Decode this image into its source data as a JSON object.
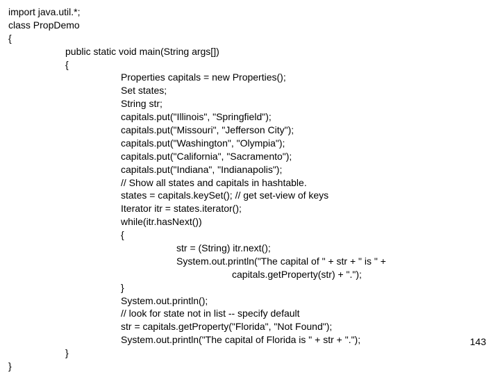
{
  "page_number": "143",
  "code": {
    "l01": "import java.util.*;",
    "l02": "class PropDemo",
    "l03": "{",
    "l04": "public static void main(String args[])",
    "l05": "{",
    "l06": "Properties capitals = new Properties();",
    "l07": "Set states;",
    "l08": "String str;",
    "l09": "capitals.put(\"Illinois\", \"Springfield\");",
    "l10": "capitals.put(\"Missouri\", \"Jefferson City\");",
    "l11": "capitals.put(\"Washington\", \"Olympia\");",
    "l12": "capitals.put(\"California\", \"Sacramento\");",
    "l13": "capitals.put(\"Indiana\", \"Indianapolis\");",
    "l14": "// Show all states and capitals in hashtable.",
    "l15": "states = capitals.keySet(); // get set-view of keys",
    "l16": "Iterator itr = states.iterator();",
    "l17": "while(itr.hasNext())",
    "l18": "{",
    "l19": "str = (String) itr.next();",
    "l20": "System.out.println(\"The capital of \" + str + \" is \" +",
    "l21": "capitals.getProperty(str) + \".\");",
    "l22": "}",
    "l23": "System.out.println();",
    "l24": "// look for state not in list -- specify default",
    "l25": "str = capitals.getProperty(\"Florida\", \"Not Found\");",
    "l26": "System.out.println(\"The capital of Florida is \" + str + \".\");",
    "l27": "}",
    "l28": "}"
  }
}
